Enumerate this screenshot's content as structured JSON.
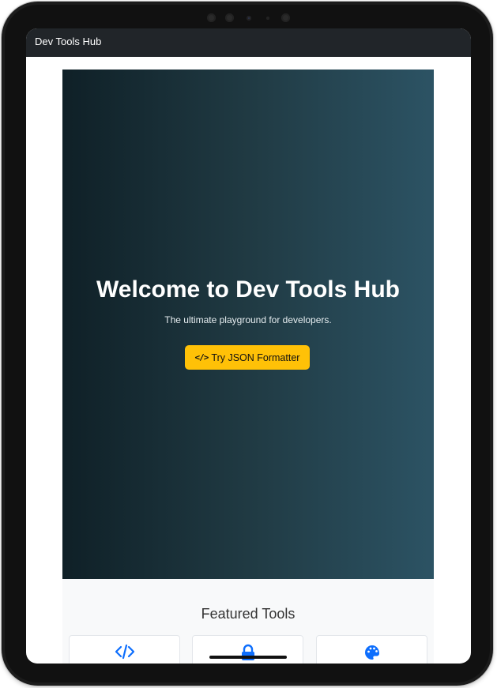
{
  "navbar": {
    "brand": "Dev Tools Hub"
  },
  "hero": {
    "title": "Welcome to Dev Tools Hub",
    "subtitle": "The ultimate playground for developers.",
    "cta_label": "Try JSON Formatter",
    "cta_icon": "code-icon",
    "background_gradient": [
      "#0f2027",
      "#203a43",
      "#2c5364"
    ],
    "cta_color": "#ffc107"
  },
  "featured": {
    "title": "Featured Tools",
    "tools": [
      {
        "icon": "code-icon"
      },
      {
        "icon": "lock-icon"
      },
      {
        "icon": "palette-icon"
      }
    ],
    "icon_color": "#0d6efd"
  },
  "colors": {
    "navbar_bg": "#212529",
    "featured_bg": "#f8f9fa"
  }
}
